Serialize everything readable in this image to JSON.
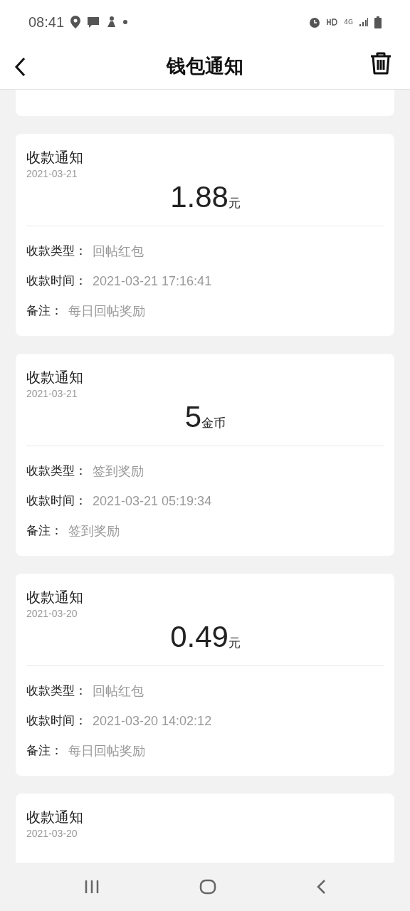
{
  "status_bar": {
    "time": "08:41",
    "network": "4G"
  },
  "header": {
    "title": "钱包通知"
  },
  "notices": [
    {
      "title": "收款通知",
      "date": "2021-03-21",
      "amount": "1.88",
      "unit": "元",
      "fields": [
        {
          "label": "收款类型：",
          "value": "回帖红包"
        },
        {
          "label": "收款时间：",
          "value": "2021-03-21 17:16:41"
        },
        {
          "label": "备注：",
          "value": "每日回帖奖励"
        }
      ]
    },
    {
      "title": "收款通知",
      "date": "2021-03-21",
      "amount": "5",
      "unit": "金币",
      "fields": [
        {
          "label": "收款类型：",
          "value": "签到奖励"
        },
        {
          "label": "收款时间：",
          "value": "2021-03-21 05:19:34"
        },
        {
          "label": "备注：",
          "value": "签到奖励"
        }
      ]
    },
    {
      "title": "收款通知",
      "date": "2021-03-20",
      "amount": "0.49",
      "unit": "元",
      "fields": [
        {
          "label": "收款类型：",
          "value": "回帖红包"
        },
        {
          "label": "收款时间：",
          "value": "2021-03-20 14:02:12"
        },
        {
          "label": "备注：",
          "value": "每日回帖奖励"
        }
      ]
    },
    {
      "title": "收款通知",
      "date": "2021-03-20"
    }
  ]
}
